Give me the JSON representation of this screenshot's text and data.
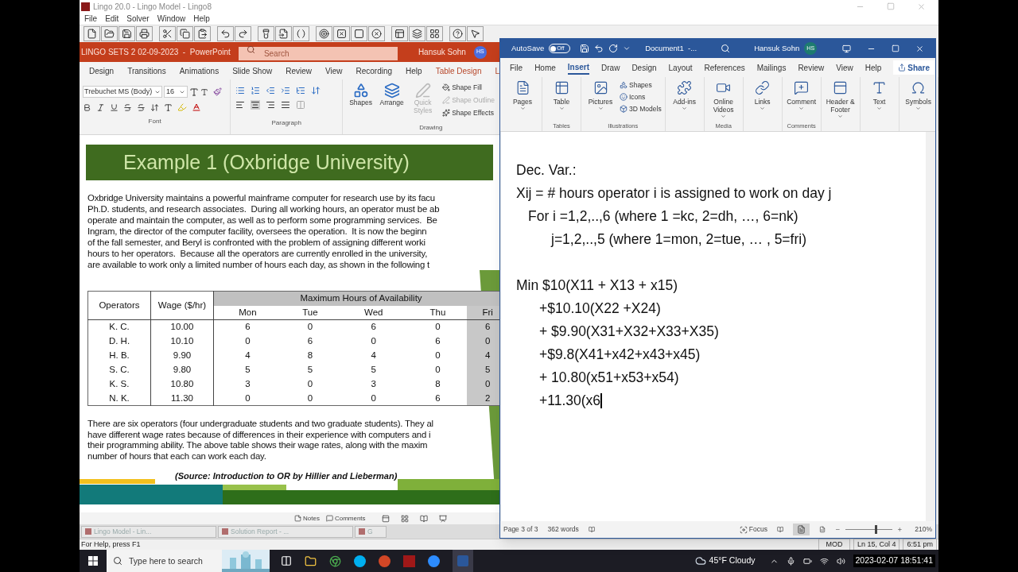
{
  "lingo": {
    "title": "Lingo 20.0 - Lingo Model - Lingo8",
    "menu": [
      "File",
      "Edit",
      "Solver",
      "Window",
      "Help"
    ],
    "minimized": [
      "Lingo Model - Lin...",
      "Solution Report - ...",
      "G"
    ],
    "status": "For Help, press F1",
    "indicators": [
      "MOD",
      "Ln 15, Col 4",
      "6:51 pm"
    ]
  },
  "powerpoint": {
    "title": "LINGO SETS 2 02-09-2023  -  PowerPoint",
    "search": {
      "placeholder": "Search"
    },
    "user": "Hansuk Sohn",
    "initials": "HS",
    "tabs": [
      {
        "label": "Design",
        "kind": "normal"
      },
      {
        "label": "Transitions",
        "kind": "normal"
      },
      {
        "label": "Animations",
        "kind": "normal"
      },
      {
        "label": "Slide Show",
        "kind": "normal"
      },
      {
        "label": "Review",
        "kind": "normal"
      },
      {
        "label": "View",
        "kind": "normal"
      },
      {
        "label": "Recording",
        "kind": "normal"
      },
      {
        "label": "Help",
        "kind": "normal"
      },
      {
        "label": "Table Design",
        "kind": "contextual"
      },
      {
        "label": "L",
        "kind": "contextual"
      }
    ],
    "font": {
      "family": "Trebuchet MS (Body)",
      "size": "16"
    },
    "groups": [
      "Font",
      "Paragraph",
      "Drawing"
    ],
    "drawing_tools": [
      {
        "label": "Shapes",
        "disabled": false
      },
      {
        "label": "Arrange",
        "disabled": false
      },
      {
        "label": "Quick Styles",
        "disabled": true
      }
    ],
    "shape_menus": [
      {
        "label": "Shape Fill",
        "disabled": false
      },
      {
        "label": "Shape Outline",
        "disabled": true
      },
      {
        "label": "Shape Effects",
        "disabled": false
      }
    ],
    "slide": {
      "title": "Example 1 (Oxbridge University)",
      "intro": [
        "Oxbridge University maintains a powerful mainframe computer for research use by its facu",
        "Ph.D. students, and research associates.  During all working hours, an operator must be ab",
        "operate and maintain the computer, as well as to perform some programming services.  Be",
        "Ingram, the director of the computer facility, oversees the operation.  It is now the beginn",
        "of the fall semester, and Beryl is confronted with the problem of assigning different worki",
        "hours to her operators.  Because all the operators are currently enrolled in the university,",
        "are available to work only a limited number of hours each day, as shown in the following t"
      ],
      "table": {
        "columns": [
          "Operators",
          "Wage ($/hr)"
        ],
        "group_header": "Maximum Hours of Availability",
        "days": [
          "Mon",
          "Tue",
          "Wed",
          "Thu",
          "Fri"
        ],
        "rows": [
          [
            "K. C.",
            "10.00",
            "6",
            "0",
            "6",
            "0",
            "6"
          ],
          [
            "D. H.",
            "10.10",
            "0",
            "6",
            "0",
            "6",
            "0"
          ],
          [
            "H. B.",
            "9.90",
            "4",
            "8",
            "4",
            "0",
            "4"
          ],
          [
            "S. C.",
            "9.80",
            "5",
            "5",
            "5",
            "0",
            "5"
          ],
          [
            "K. S.",
            "10.80",
            "3",
            "0",
            "3",
            "8",
            "0"
          ],
          [
            "N. K.",
            "11.30",
            "0",
            "0",
            "0",
            "6",
            "2"
          ]
        ]
      },
      "outro": [
        "There are six operators (four undergraduate students and two graduate students). They al",
        "have different wage rates because of differences in their experience with computers and i",
        "their programming ability. The above table shows their wage rates, along with the maxim",
        "number of hours that each can work each day."
      ],
      "source": "(Source: Introduction to OR by Hillier and Lieberman)"
    },
    "status_buttons": [
      "Notes",
      "Comments"
    ]
  },
  "word": {
    "autosave": "AutoSave",
    "autosave_on": false,
    "toggle_label": "Off",
    "document": "Document1  -...",
    "user": "Hansuk Sohn",
    "initials": "HS",
    "tabs": [
      {
        "label": "File",
        "selected": false
      },
      {
        "label": "Home",
        "selected": false
      },
      {
        "label": "Insert",
        "selected": true
      },
      {
        "label": "Draw",
        "selected": false
      },
      {
        "label": "Design",
        "selected": false
      },
      {
        "label": "Layout",
        "selected": false
      },
      {
        "label": "References",
        "selected": false
      },
      {
        "label": "Mailings",
        "selected": false
      },
      {
        "label": "Review",
        "selected": false
      },
      {
        "label": "View",
        "selected": false
      },
      {
        "label": "Help",
        "selected": false
      }
    ],
    "share": "Share",
    "groups": [
      {
        "items": [
          "Pages"
        ]
      },
      {
        "items": [
          "Table"
        ],
        "label": "Tables"
      },
      {
        "items": [
          "Pictures"
        ],
        "small": [
          "Shapes",
          "Icons",
          "3D Models"
        ],
        "label": "Illustrations"
      },
      {
        "items": [
          "Add-ins"
        ]
      },
      {
        "items": [
          "Online Videos"
        ],
        "label": "Media"
      },
      {
        "items": [
          "Links"
        ]
      },
      {
        "items": [
          "Comment"
        ],
        "label": "Comments"
      },
      {
        "items": [
          "Header & Footer"
        ]
      },
      {
        "items": [
          "Text"
        ]
      },
      {
        "items": [
          "Symbols"
        ]
      }
    ],
    "lines": [
      {
        "kind": "plain",
        "text": "Dec. Var.:"
      },
      {
        "kind": "plain",
        "text": "Xij = # hours operator i is assigned to work on day j"
      },
      {
        "kind": "indent",
        "text": "For i =1,2,..,6 (where 1 =kc, 2=dh, …, 6=nk)"
      },
      {
        "kind": "deep",
        "text": "j=1,2,..,5 (where 1=mon, 2=tue, … , 5=fri)"
      },
      {
        "kind": "blank"
      },
      {
        "kind": "plain",
        "text": "Min $10(X11 + X13 + x15)"
      },
      {
        "kind": "term",
        "text": "+$10.10(X22 +X24)"
      },
      {
        "kind": "term",
        "text": "+ $9.90(X31+X32+X33+X35)"
      },
      {
        "kind": "term",
        "text": "+$9.8(X41+x42+x43+x45)"
      },
      {
        "kind": "term",
        "text": "+ 10.80(x51+x53+x54)"
      },
      {
        "kind": "term",
        "text": "+11.30(x6",
        "cursor": true
      }
    ],
    "status": {
      "page": "Page 3 of 3",
      "words": "362 words",
      "focus": "Focus",
      "zoom": {
        "level": 0.68
      },
      "zoom_label": "210%"
    }
  },
  "taskbar": {
    "search": {
      "placeholder": "Type here to search"
    },
    "weather": "45°F Cloudy",
    "timestamp": "2023-02-07 18:51:41"
  }
}
